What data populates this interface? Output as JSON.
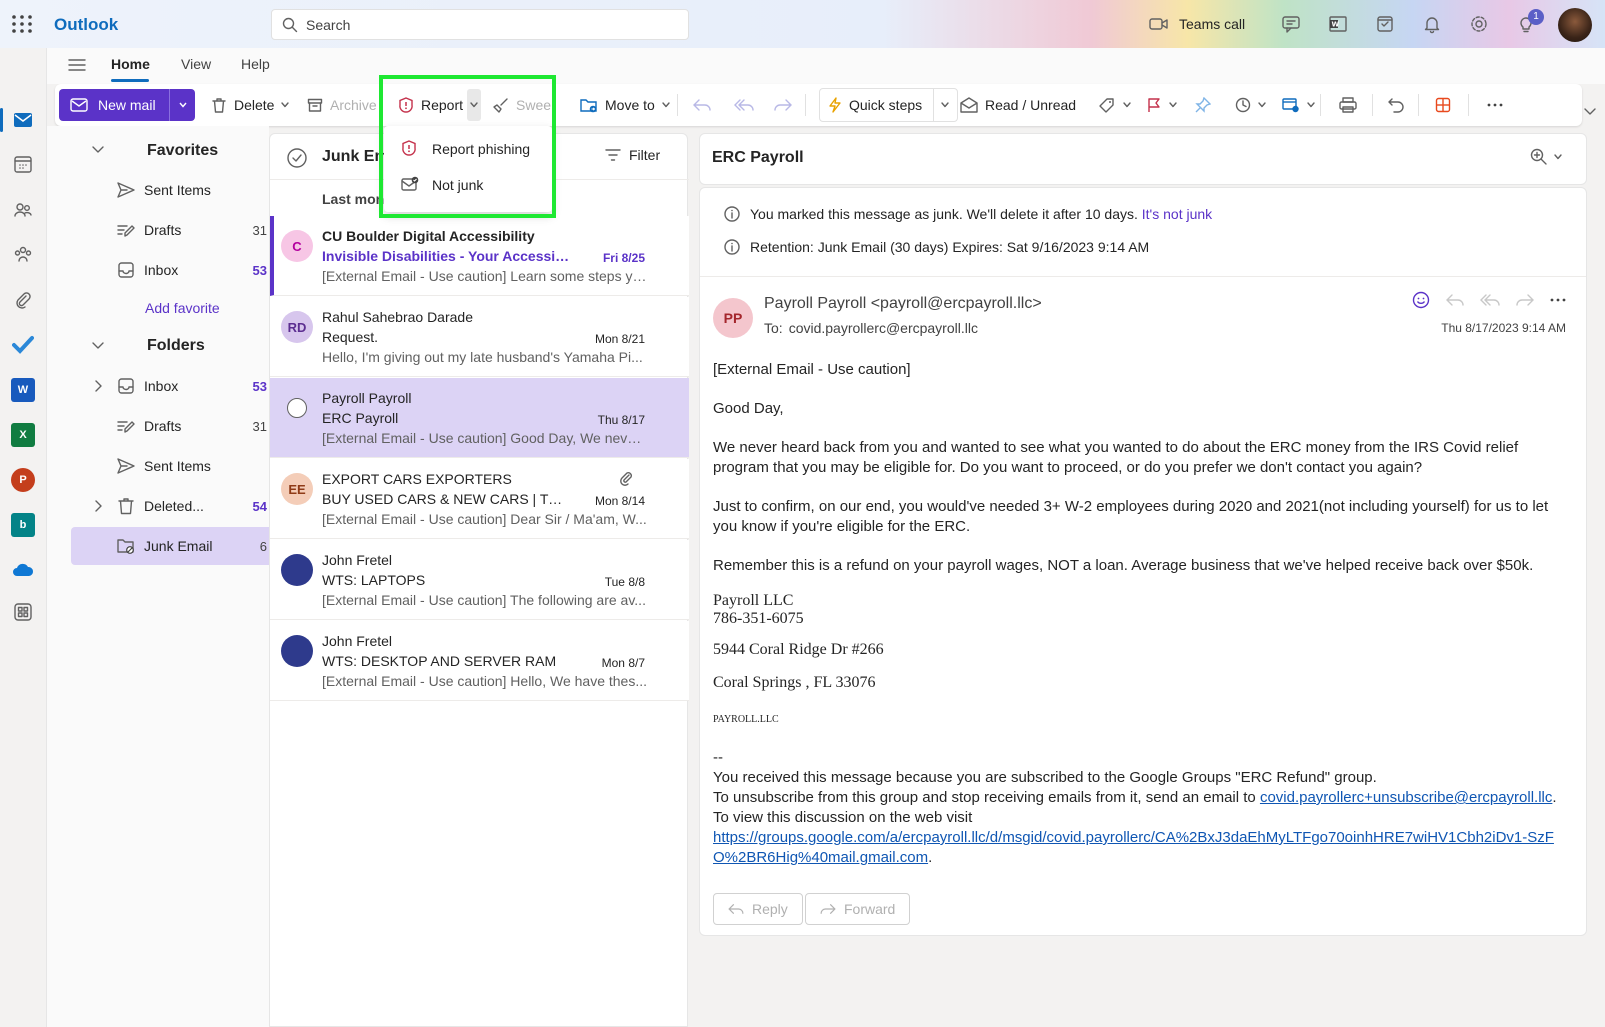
{
  "app": {
    "name": "Outlook"
  },
  "search": {
    "placeholder": "Search"
  },
  "topbar": {
    "teams_call": "Teams call",
    "notif_count": "1"
  },
  "ribbon_tabs": {
    "home": "Home",
    "view": "View",
    "help": "Help"
  },
  "ribbon": {
    "new_mail": "New mail",
    "delete": "Delete",
    "archive": "Archive",
    "report": "Report",
    "sweep": "Swee",
    "move_to": "Move to",
    "quick_steps": "Quick steps",
    "read_unread": "Read / Unread"
  },
  "report_menu": {
    "report_phishing": "Report phishing",
    "not_junk": "Not junk"
  },
  "favorites": {
    "title": "Favorites",
    "items": [
      {
        "label": "Sent Items",
        "count": ""
      },
      {
        "label": "Drafts",
        "count": "31"
      },
      {
        "label": "Inbox",
        "count": "53"
      }
    ],
    "add": "Add favorite"
  },
  "folders": {
    "title": "Folders",
    "items": [
      {
        "label": "Inbox",
        "count": "53"
      },
      {
        "label": "Drafts",
        "count": "31"
      },
      {
        "label": "Sent Items",
        "count": ""
      },
      {
        "label": "Deleted...",
        "count": "54"
      },
      {
        "label": "Junk Email",
        "count": "6"
      }
    ]
  },
  "list": {
    "title": "Junk Email",
    "filter": "Filter",
    "group": "Last month",
    "messages": [
      {
        "initials": "C",
        "sender": "CU Boulder Digital Accessibility",
        "subject": "Invisible Disabilities - Your Accessibility ...",
        "date": "Fri 8/25",
        "preview": "[External Email - Use caution] Learn some steps yo..."
      },
      {
        "initials": "RD",
        "sender": "Rahul Sahebrao Darade",
        "subject": "Request.",
        "date": "Mon 8/21",
        "preview": "Hello, I'm giving out my late husband's Yamaha Pi..."
      },
      {
        "initials": "",
        "sender": "Payroll Payroll",
        "subject": "ERC Payroll",
        "date": "Thu 8/17",
        "preview": "[External Email - Use caution] Good Day, We never..."
      },
      {
        "initials": "EE",
        "sender": "EXPORT CARS EXPORTERS",
        "subject": "BUY USED CARS & NEW CARS | TOYOT...",
        "date": "Mon 8/14",
        "preview": "[External Email - Use caution] Dear Sir / Ma'am, W..."
      },
      {
        "initials": "",
        "sender": "John Fretel",
        "subject": "WTS: LAPTOPS",
        "date": "Tue 8/8",
        "preview": "[External Email - Use caution] The following are av..."
      },
      {
        "initials": "",
        "sender": "John Fretel",
        "subject": "WTS: DESKTOP AND SERVER RAM",
        "date": "Mon 8/7",
        "preview": "[External Email - Use caution] Hello, We have thes..."
      }
    ]
  },
  "reading": {
    "subject": "ERC Payroll",
    "notice_junk": "You marked this message as junk. We'll delete it after 10 days.",
    "notice_link": "It's not junk",
    "notice_retention": "Retention: Junk Email (30 days) Expires: Sat 9/16/2023 9:14 AM",
    "avatar": "PP",
    "from": "Payroll Payroll <payroll@ercpayroll.llc>",
    "to_label": "To:",
    "to": "covid.payrollerc@ercpayroll.llc",
    "date": "Thu 8/17/2023 9:14 AM",
    "body": {
      "caution": "[External Email - Use caution]",
      "greeting": "Good Day,",
      "p1": "We never heard back from you and wanted to see what you wanted to do about the ERC money from the IRS Covid relief program that you may be eligible for. Do you want to proceed, or do you prefer we don't contact you again?",
      "p2": "Just to confirm, on our end, you would've needed 3+ W-2 employees during 2020 and 2021(not including yourself) for us to let you know if you're eligible for the ERC.",
      "p3": "Remember this is a refund on your payroll wages, NOT a loan. Average business that we've helped receive back over $50k.",
      "sig_name": "Payroll LLC",
      "sig_phone": "786-351-6075",
      "sig_addr1": "5944 Coral Ridge Dr #266",
      "sig_addr2": "Coral Springs , FL 33076",
      "sig_small": "PAYROLL.LLC",
      "dashes": "--",
      "footer1": "You received this message because you are subscribed to the Google Groups \"ERC Refund\" group.",
      "footer2": "To unsubscribe from this group and stop receiving emails from it, send an email to ",
      "footer2_link": "covid.payrollerc+unsubscribe@ercpayroll.llc",
      "footer2_end": ".",
      "footer3": "To view this discussion on the web visit",
      "footer3_link": "https://groups.google.com/a/ercpayroll.llc/d/msgid/covid.payrollerc/CA%2BxJ3daEhMyLTFgo70oinhHRE7wiHV1Cbh2iDv1-SzFO%2BR6Hig%40mail.gmail.com",
      "footer3_end": "."
    },
    "reply": "Reply",
    "forward": "Forward"
  },
  "colors": {
    "accent": "#5b33c8",
    "highlight": "#1ee832",
    "selected": "#dcd3f5"
  }
}
